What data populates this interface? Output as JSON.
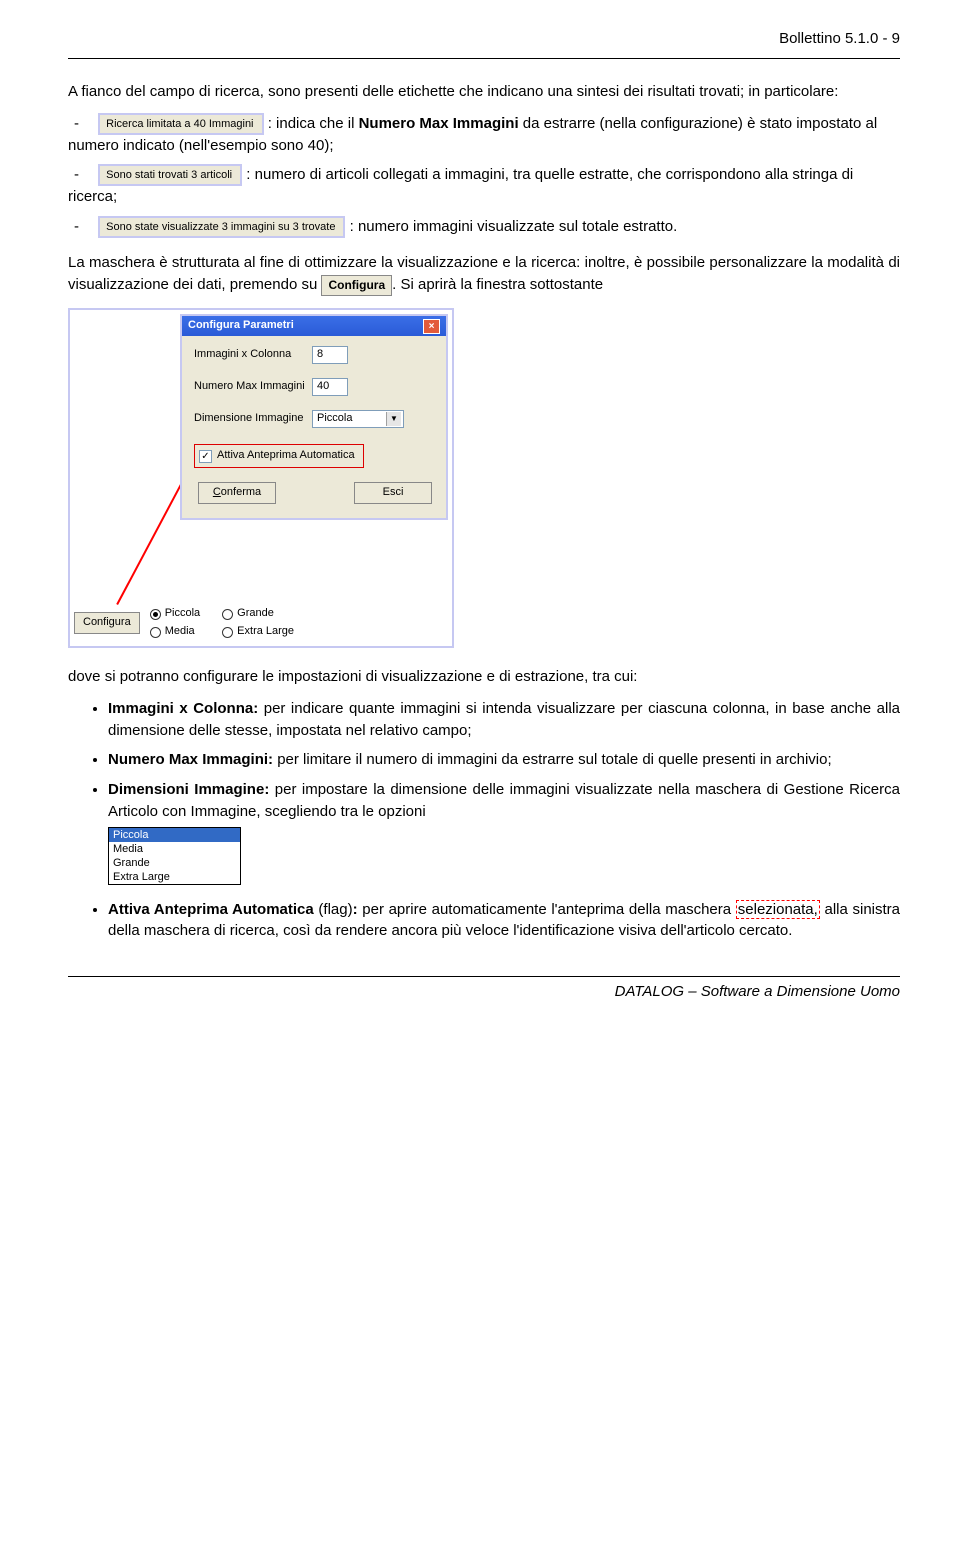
{
  "header": {
    "right": "Bollettino 5.1.0 - 9"
  },
  "p1": "A fianco del campo di ricerca, sono presenti delle etichette che indicano una sintesi dei risultati trovati; in particolare:",
  "chips": {
    "c1": "Ricerca limitata a 40 Immagini",
    "c2": "Sono stati trovati 3 articoli",
    "c3": "Sono state visualizzate 3 immagini su 3 trovate"
  },
  "b1_a": ": indica che il ",
  "b1_bold": "Numero Max Immagini",
  "b1_b": " da estrarre (nella configurazione) è stato impostato al numero indicato (nell'esempio sono 40);",
  "b2": ": numero di articoli collegati a immagini, tra quelle estratte, che corrispondono alla stringa di ricerca;",
  "b3": ": numero immagini visualizzate sul totale estratto.",
  "p2a": "La maschera è strutturata al fine di ottimizzare la visualizzazione e la ricerca: inoltre, è possibile personalizzare la modalità di visualizzazione dei dati, premendo su ",
  "p2btn": "Configura",
  "p2b": ". Si aprirà la finestra sottostante",
  "dialog": {
    "title": "Configura Parametri",
    "rows": {
      "r1l": "Immagini x Colonna",
      "r1v": "8",
      "r2l": "Numero Max Immagini",
      "r2v": "40",
      "r3l": "Dimensione Immagine",
      "r3v": "Piccola"
    },
    "chk": "Attiva Anteprima Automatica",
    "ok": "Conferma",
    "esc": "Esci",
    "cfg": "Configura",
    "radios": {
      "a": "Piccola",
      "b": "Grande",
      "c": "Media",
      "d": "Extra Large"
    }
  },
  "p3": "dove si potranno configurare le impostazioni di visualizzazione e di estrazione, tra cui:",
  "li1_b": "Immagini x Colonna:",
  "li1": " per indicare quante immagini si intenda visualizzare per ciascuna colonna, in base anche alla dimensione delle stesse, impostata nel relativo campo;",
  "li2_b": "Numero Max Immagini:",
  "li2": " per limitare il numero di immagini da estrarre sul totale di quelle presenti in archivio;",
  "li3_b": "Dimensioni Immagine:",
  "li3": " per impostare la dimensione delle immagini visualizzate nella maschera di Gestione Ricerca Articolo con Immagine, scegliendo tra le opzioni",
  "opts": {
    "o1": "Piccola",
    "o2": "Media",
    "o3": "Grande",
    "o4": "Extra Large"
  },
  "li4_b": "Attiva Anteprima Automatica",
  "li4_flag": " (flag)",
  "li4_colon": ":",
  "li4a": " per aprire automaticamente l'anteprima della maschera ",
  "li4_sel": "selezionata,",
  "li4b": " alla sinistra della maschera di ricerca, così da rendere ancora più veloce l'identificazione visiva dell'articolo cercato.",
  "footer": "DATALOG – Software a Dimensione Uomo"
}
